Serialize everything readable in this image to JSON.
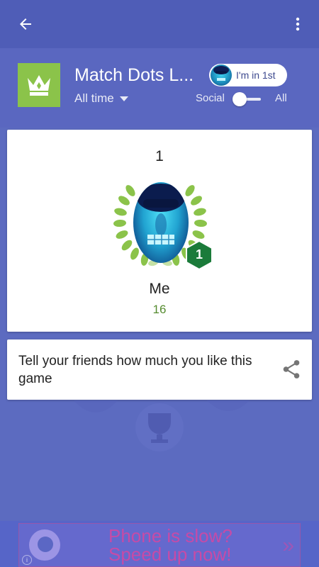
{
  "appbar": {
    "back_icon": "arrow-left-icon",
    "menu_icon": "more-vert-icon"
  },
  "header": {
    "game_icon": "crown-icon",
    "game_title": "Match Dots L...",
    "time_filter": "All time",
    "rank_chip_label": "I'm in 1st",
    "toggle": {
      "left_label": "Social",
      "right_label": "All",
      "selected": "Social"
    }
  },
  "player_card": {
    "rank": "1",
    "badge_rank": "1",
    "name": "Me",
    "score": "16"
  },
  "share_card": {
    "text": "Tell your friends how much you like this game",
    "icon": "share-icon"
  },
  "ad": {
    "line1": "Phone is slow?",
    "line2": "Speed up now!",
    "chevron": "»",
    "info": "i"
  },
  "colors": {
    "appbar": "#4f5db7",
    "background": "#5c6bc0",
    "game_icon_bg": "#8bc34a",
    "score": "#558b2f",
    "badge": "#1b7b3a"
  }
}
